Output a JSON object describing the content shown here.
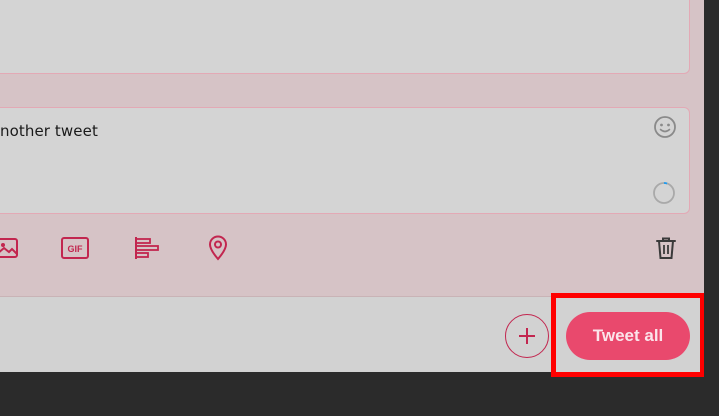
{
  "composer": {
    "tweet_text": "nother tweet",
    "char_progress_fraction": 0.05
  },
  "toolbar": {
    "gif_label": "GIF",
    "icons": [
      "image-icon",
      "gif-icon",
      "poll-icon",
      "location-icon",
      "trash-icon"
    ]
  },
  "footer": {
    "add_button_symbol": "+",
    "tweet_all_label": "Tweet all"
  },
  "colors": {
    "accent": "#e9496d",
    "icon_accent": "#c2264f",
    "highlight": "#ff0000"
  }
}
